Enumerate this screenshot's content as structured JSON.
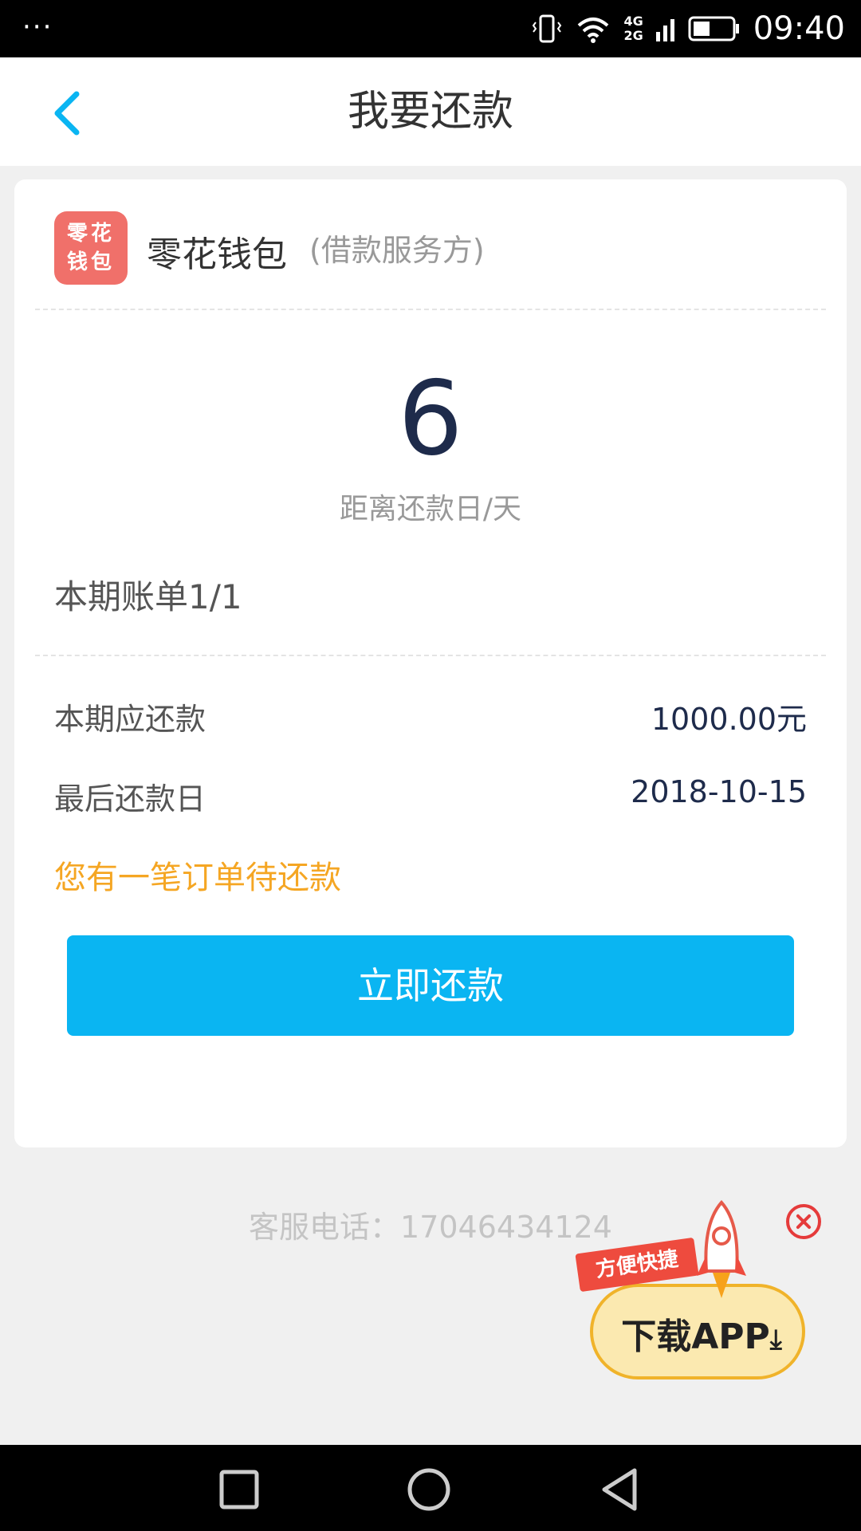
{
  "status_bar": {
    "dots": "···",
    "network_4g": "4G",
    "network_2g": "2G",
    "time": "09:40"
  },
  "header": {
    "title": "我要还款"
  },
  "provider": {
    "logo_line1": "零花",
    "logo_line2": "钱包",
    "name": "零花钱包",
    "role": "(借款服务方)"
  },
  "countdown": {
    "days": "6",
    "caption": "距离还款日/天"
  },
  "bill": {
    "period": "本期账单1/1",
    "amount_label": "本期应还款",
    "amount_value": "1000.00元",
    "due_label": "最后还款日",
    "due_value": "2018-10-15",
    "pending_note": "您有一笔订单待还款"
  },
  "actions": {
    "repay_label": "立即还款"
  },
  "footer": {
    "service_phone": "客服电话：17046434124"
  },
  "ad": {
    "banner": "方便快捷",
    "main": "下载APP"
  },
  "colors": {
    "accent": "#0ab5f2",
    "warning": "#f5a623",
    "number": "#1e2b4b"
  },
  "icons": {
    "back": "chevron-left-icon",
    "close": "close-circle-icon",
    "download": "download-icon"
  }
}
